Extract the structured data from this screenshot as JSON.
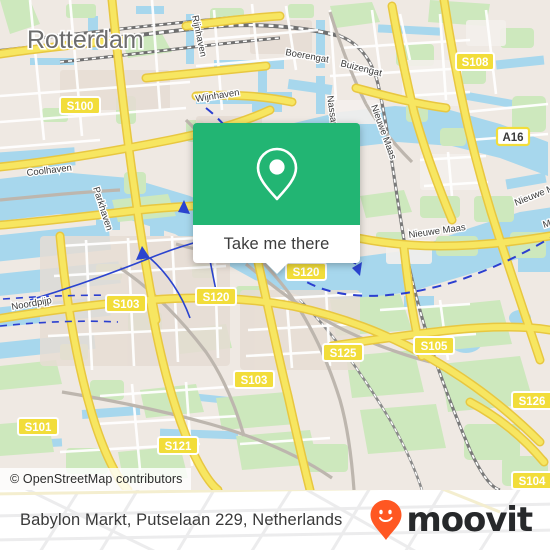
{
  "map": {
    "provider_attribution": "© OpenStreetMap contributors",
    "city_label": "Rotterdam",
    "water_labels": [
      {
        "text": "Nieuwe Maas"
      },
      {
        "text": "Nieuwe Maas"
      },
      {
        "text": "Nieuwe Maas"
      },
      {
        "text": "Nieuwe Maas"
      },
      {
        "text": "Nassauhaven"
      },
      {
        "text": "Wijnhaven"
      },
      {
        "text": "Boerengat"
      },
      {
        "text": "Buizengat"
      },
      {
        "text": "Coolhaven"
      },
      {
        "text": "Parkhaven"
      },
      {
        "text": "Noordpijp"
      },
      {
        "text": "Rijnhaven"
      }
    ],
    "road_shields": [
      {
        "label": "S100",
        "type": "secondary"
      },
      {
        "label": "S108",
        "type": "secondary"
      },
      {
        "label": "A16",
        "type": "motorway"
      },
      {
        "label": "S120",
        "type": "secondary"
      },
      {
        "label": "S120",
        "type": "secondary"
      },
      {
        "label": "S103",
        "type": "secondary"
      },
      {
        "label": "S103",
        "type": "secondary"
      },
      {
        "label": "S105",
        "type": "secondary"
      },
      {
        "label": "S125",
        "type": "secondary"
      },
      {
        "label": "S126",
        "type": "secondary"
      },
      {
        "label": "S101",
        "type": "secondary"
      },
      {
        "label": "S121",
        "type": "secondary"
      },
      {
        "label": "S104",
        "type": "secondary"
      }
    ],
    "colors": {
      "land": "#efe9e3",
      "water": "#a7d7ed",
      "green": "#cde8bd",
      "road_yellow": "#f7e05a",
      "road_white": "#ffffff",
      "rail": "#6b6b6b",
      "ferry": "#2b44cf"
    }
  },
  "popup": {
    "cta_label": "Take me there",
    "icon": "map-pin-icon",
    "accent_color": "#22b573"
  },
  "footer": {
    "address": "Babylon Markt, Putselaan 229, Netherlands",
    "brand_name": "moovit",
    "brand_icon": "moovit-smiley-pin-icon",
    "brand_color": "#ff5722"
  }
}
